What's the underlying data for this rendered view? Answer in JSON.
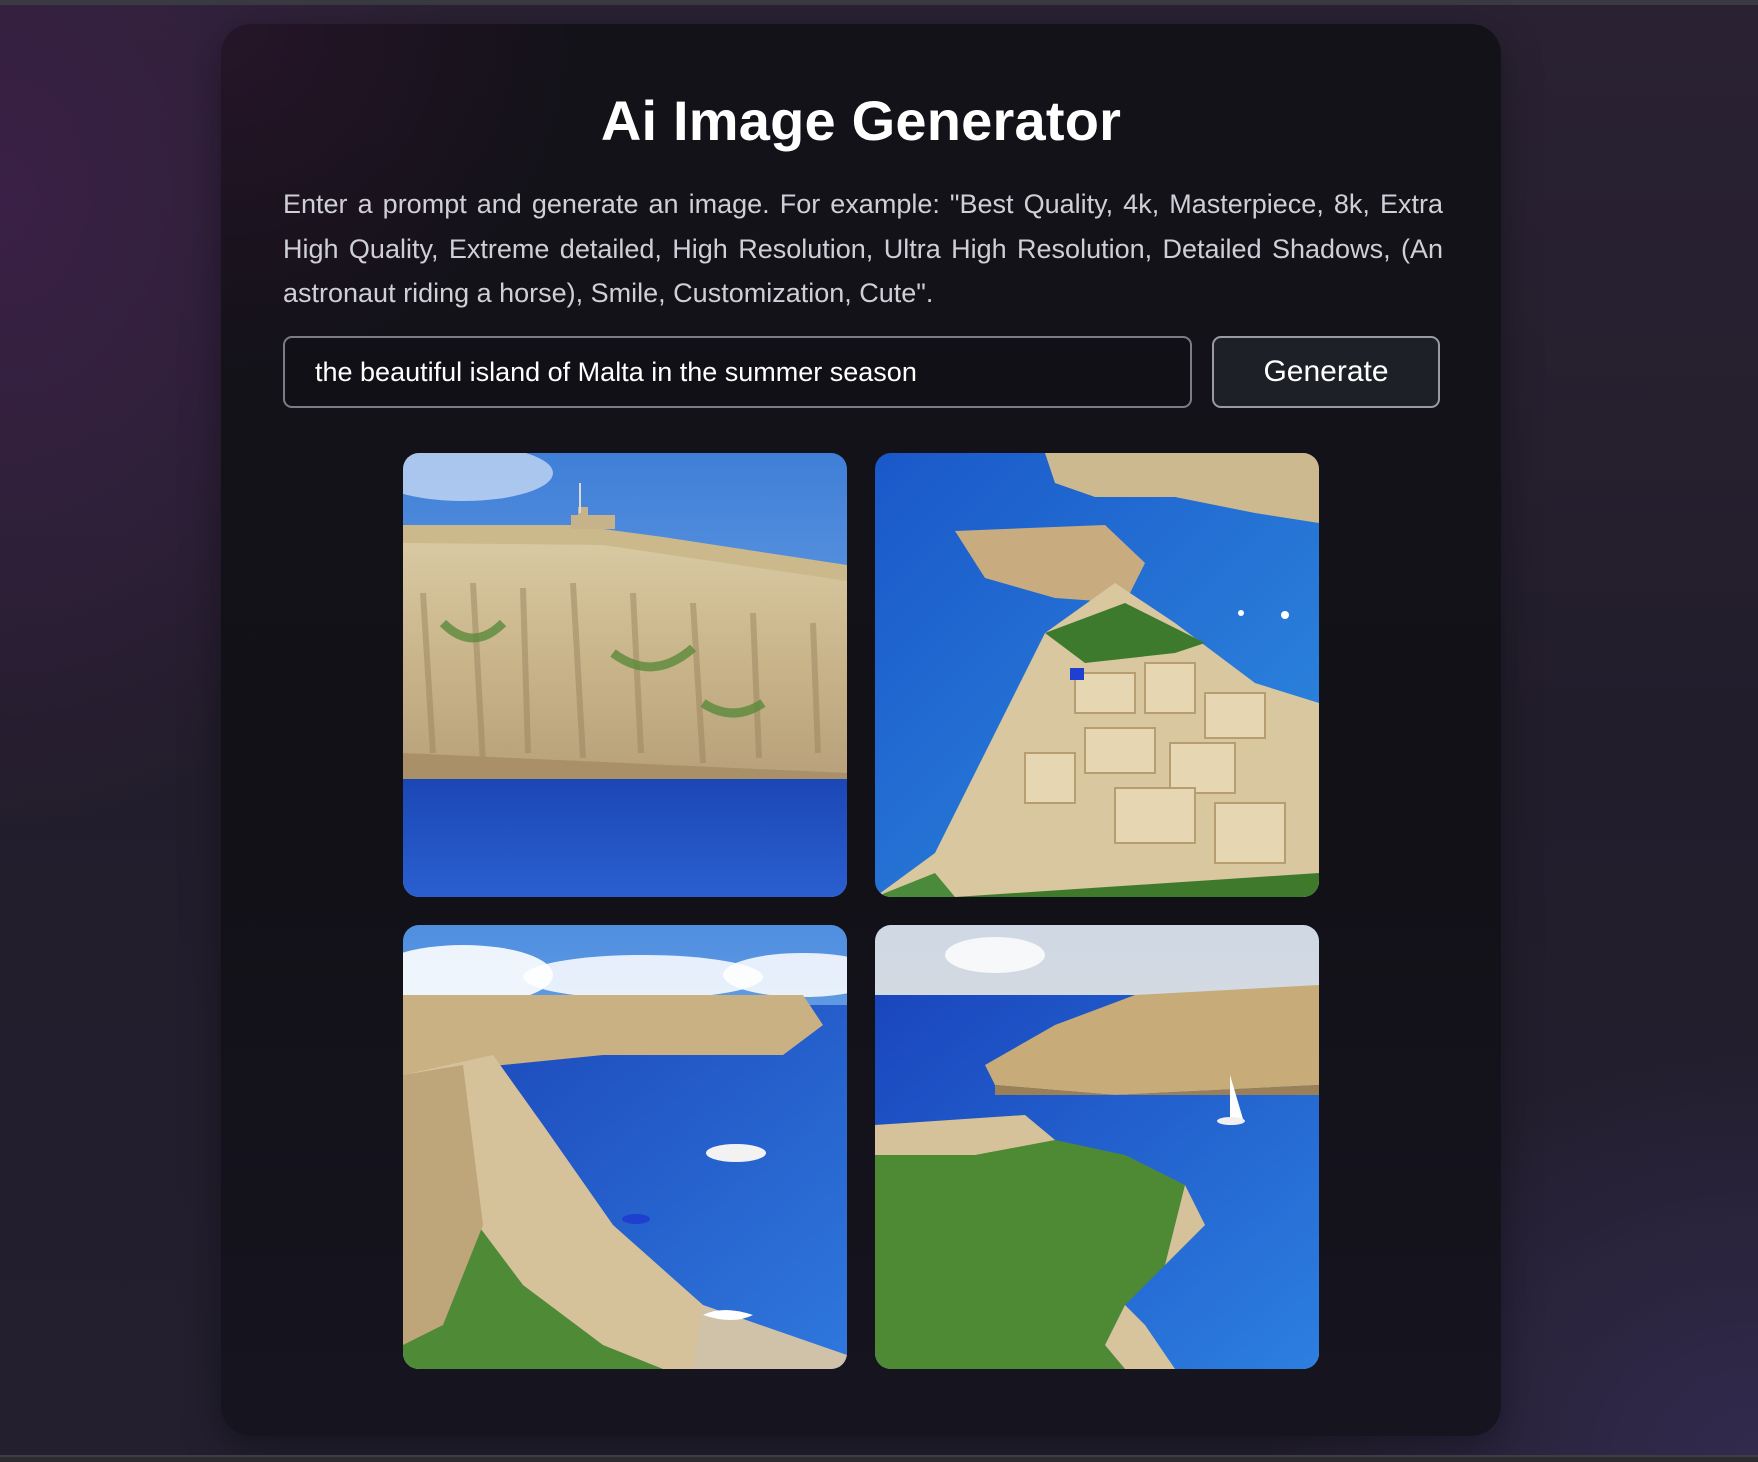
{
  "app": {
    "title": "Ai Image Generator",
    "description": "Enter a prompt and generate an image. For example: \"Best Quality, 4k, Masterpiece, 8k, Extra High Quality, Extreme detailed, High Resolution, Ultra High Resolution, Detailed Shadows, (An astronaut riding a horse), Smile, Customization, Cute\"."
  },
  "form": {
    "prompt_value": "the beautiful island of Malta in the summer season",
    "generate_label": "Generate"
  },
  "results": {
    "images": [
      {
        "subject": "Malta cliff with fort over blue sea"
      },
      {
        "subject": "Aerial view of Malta coastal town"
      },
      {
        "subject": "Malta bay with beach and boat"
      },
      {
        "subject": "Malta green peninsula and sailboat"
      }
    ]
  },
  "colors": {
    "background": "#231f2f",
    "card": "#131218",
    "accent_text": "#ffffff",
    "muted_text": "#cfcfd6",
    "sea": "#1f4fbd"
  }
}
